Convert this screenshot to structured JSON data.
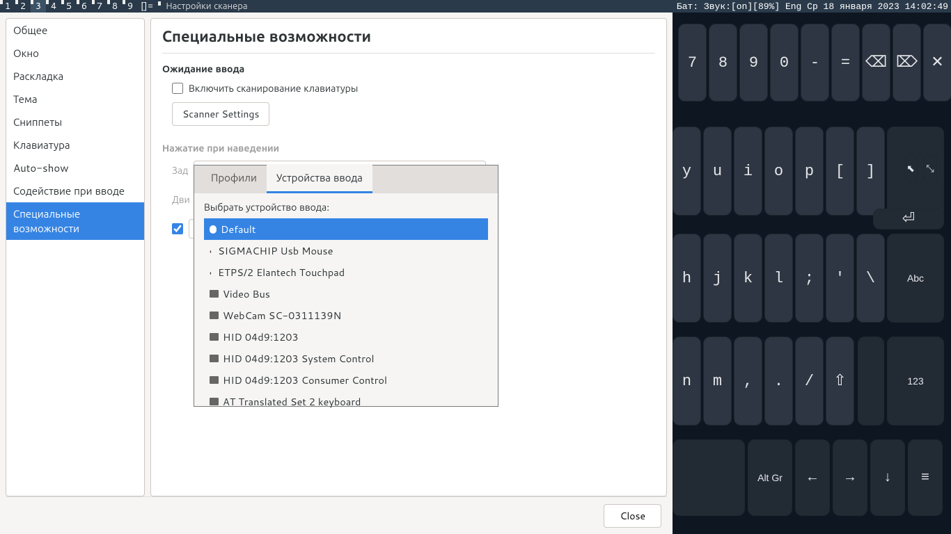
{
  "topbar": {
    "workspaces": [
      "1",
      "2",
      "3",
      "4",
      "5",
      "6",
      "7",
      "8",
      "9"
    ],
    "active_ws": "3",
    "layout": "[]=",
    "window_title": "Настройки сканера",
    "status": "Бат: Звук:[on][89%] Eng Ср 18 января 2023 14:02:49"
  },
  "sidebar": {
    "items": [
      "Общее",
      "Окно",
      "Раскладка",
      "Тема",
      "Сниппеты",
      "Клавиатура",
      "Auto-show",
      "Содействие при вводе",
      "Специальные возможности"
    ],
    "selected_index": 8
  },
  "main": {
    "title": "Специальные возможности",
    "section1_label": "Ожидание ввода",
    "enable_scan_label": "Включить сканирование клавиатуры",
    "enable_scan_checked": false,
    "scanner_settings_btn": "Scanner Settings",
    "section2_label": "Нажатие при наведении",
    "dim_row1": "Зад",
    "dim_row2": "Дви",
    "close_btn": "Close"
  },
  "popup": {
    "tabs": [
      "Профили",
      "Устройства ввода"
    ],
    "active_tab": 1,
    "label": "Выбрать устройство ввода:",
    "devices": [
      {
        "name": "Default",
        "icon": "mic",
        "selected": true
      },
      {
        "name": "SIGMACHIP Usb Mouse",
        "icon": "mouse"
      },
      {
        "name": "ETPS/2 Elantech Touchpad",
        "icon": "mouse"
      },
      {
        "name": "Video Bus",
        "icon": "kbd"
      },
      {
        "name": "WebCam SC-0311139N",
        "icon": "kbd"
      },
      {
        "name": "HID 04d9:1203",
        "icon": "kbd"
      },
      {
        "name": "HID 04d9:1203 System Control",
        "icon": "kbd"
      },
      {
        "name": "HID 04d9:1203 Consumer Control",
        "icon": "kbd"
      },
      {
        "name": "AT Translated Set 2 keyboard",
        "icon": "kbd"
      }
    ]
  },
  "osk": {
    "row1": [
      "7",
      "8",
      "9",
      "0",
      "-",
      "=",
      "⌫",
      "⌦",
      "✕"
    ],
    "row2": [
      "y",
      "u",
      "i",
      "o",
      "p",
      "[",
      "]"
    ],
    "row2_side": [
      "⬉",
      "⤡"
    ],
    "row3": [
      "h",
      "j",
      "k",
      "l",
      ";",
      "'",
      "\\"
    ],
    "row3_side": "Abc",
    "enter": "⏎",
    "row4": [
      "n",
      "m",
      ",",
      ".",
      "/",
      "⇧"
    ],
    "row4_side": "123",
    "row5_altgr": "Alt Gr",
    "row5_arrows": [
      "←",
      "→",
      "↓",
      "≡"
    ]
  }
}
